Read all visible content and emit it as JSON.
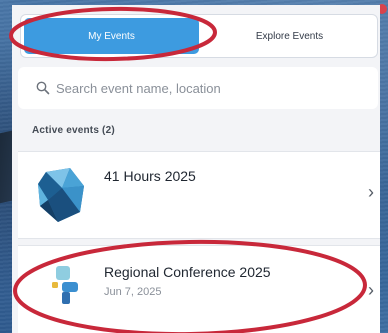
{
  "tabs": [
    {
      "label": "My Events",
      "active": true
    },
    {
      "label": "Explore Events",
      "active": false
    }
  ],
  "search": {
    "placeholder": "Search event name, location"
  },
  "section": {
    "label": "Active events (2)"
  },
  "events": [
    {
      "title": "41 Hours 2025",
      "date": ""
    },
    {
      "title": "Regional Conference 2025",
      "date": "Jun 7, 2025"
    }
  ],
  "colors": {
    "accent": "#3d9be0",
    "annotation": "#c8283a",
    "notification_dot": "#d8434d"
  }
}
